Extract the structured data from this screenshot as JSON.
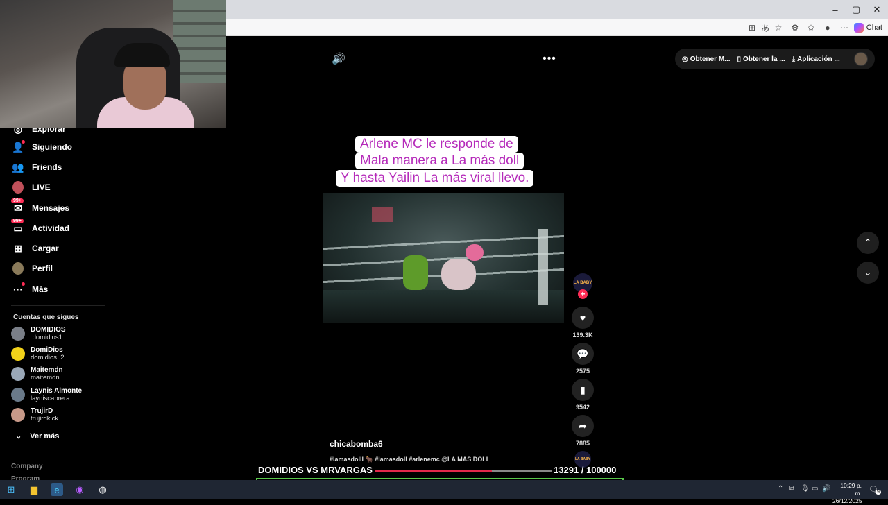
{
  "browser": {
    "chat_label": "Chat",
    "window_controls": {
      "minimize": "–",
      "maximize": "▢",
      "close": "✕"
    }
  },
  "sidebar": {
    "items": [
      {
        "label": "Explorar",
        "icon": "compass-icon"
      },
      {
        "label": "Siguiendo",
        "icon": "following-icon"
      },
      {
        "label": "Friends",
        "icon": "friends-icon"
      },
      {
        "label": "LIVE",
        "icon": "live-icon"
      },
      {
        "label": "Mensajes",
        "icon": "messages-icon",
        "badge": "99+"
      },
      {
        "label": "Actividad",
        "icon": "activity-icon",
        "badge": "99+"
      },
      {
        "label": "Cargar",
        "icon": "upload-icon"
      },
      {
        "label": "Perfil",
        "icon": "profile-icon"
      },
      {
        "label": "Más",
        "icon": "more-icon"
      }
    ],
    "following_title": "Cuentas que sigues",
    "accounts": [
      {
        "name": "DOMIDIOS",
        "handle": ".domidios1"
      },
      {
        "name": "DomiDios",
        "handle": "domidios..2"
      },
      {
        "name": "Maitemdn",
        "handle": "maitemdn"
      },
      {
        "name": "Laynis Almonte",
        "handle": "layniscabrera"
      },
      {
        "name": "TrujirD",
        "handle": "trujirdkick"
      }
    ],
    "see_more": "Ver más",
    "footer": [
      "Company",
      "Program"
    ]
  },
  "topbar": {
    "items": [
      "Obtener M...",
      "Obtener la ...",
      "Aplicación ..."
    ]
  },
  "video": {
    "caption_lines": [
      "Arlene MC le responde de",
      "Mala manera a La más doll",
      "Y hasta Yailin La más viral llevo."
    ],
    "username": "chicabomba6",
    "description": "#lamasdolll 🐂 #lamasdoll #arlenemc @LA MAS DOLL",
    "creator_badge": "LA BABY"
  },
  "actions": {
    "likes": "139.3K",
    "comments": "2575",
    "saves": "9542",
    "shares": "7885"
  },
  "overlay": {
    "versus": "DOMIDIOS VS MRVARGAS",
    "score": "13291   / 100000",
    "score_fraction": 0.66,
    "progress_fraction": 0.13
  },
  "taskbar": {
    "time": "10:29 p. m.",
    "date": "26/12/2025",
    "notifications": "9"
  }
}
